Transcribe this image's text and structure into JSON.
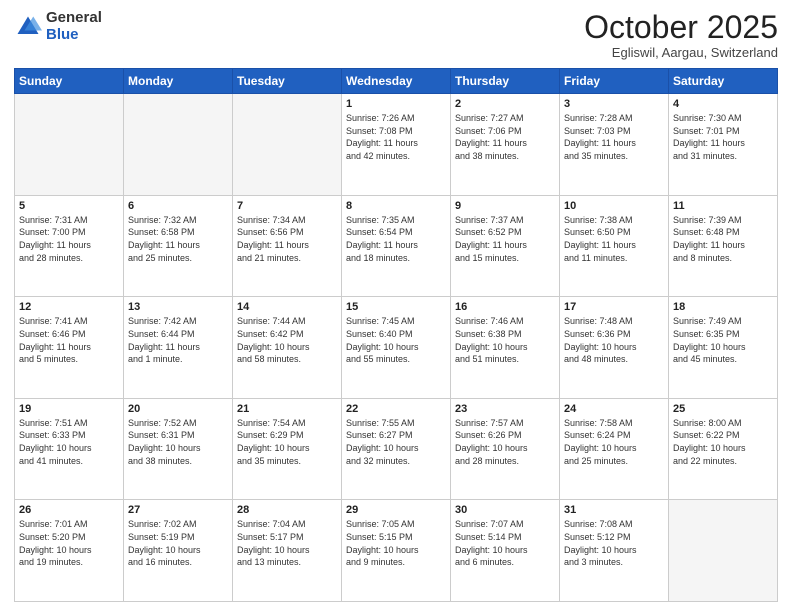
{
  "logo": {
    "general": "General",
    "blue": "Blue"
  },
  "title": {
    "month": "October 2025",
    "location": "Egliswil, Aargau, Switzerland"
  },
  "days_header": [
    "Sunday",
    "Monday",
    "Tuesday",
    "Wednesday",
    "Thursday",
    "Friday",
    "Saturday"
  ],
  "weeks": [
    [
      {
        "day": "",
        "info": ""
      },
      {
        "day": "",
        "info": ""
      },
      {
        "day": "",
        "info": ""
      },
      {
        "day": "1",
        "info": "Sunrise: 7:26 AM\nSunset: 7:08 PM\nDaylight: 11 hours\nand 42 minutes."
      },
      {
        "day": "2",
        "info": "Sunrise: 7:27 AM\nSunset: 7:06 PM\nDaylight: 11 hours\nand 38 minutes."
      },
      {
        "day": "3",
        "info": "Sunrise: 7:28 AM\nSunset: 7:03 PM\nDaylight: 11 hours\nand 35 minutes."
      },
      {
        "day": "4",
        "info": "Sunrise: 7:30 AM\nSunset: 7:01 PM\nDaylight: 11 hours\nand 31 minutes."
      }
    ],
    [
      {
        "day": "5",
        "info": "Sunrise: 7:31 AM\nSunset: 7:00 PM\nDaylight: 11 hours\nand 28 minutes."
      },
      {
        "day": "6",
        "info": "Sunrise: 7:32 AM\nSunset: 6:58 PM\nDaylight: 11 hours\nand 25 minutes."
      },
      {
        "day": "7",
        "info": "Sunrise: 7:34 AM\nSunset: 6:56 PM\nDaylight: 11 hours\nand 21 minutes."
      },
      {
        "day": "8",
        "info": "Sunrise: 7:35 AM\nSunset: 6:54 PM\nDaylight: 11 hours\nand 18 minutes."
      },
      {
        "day": "9",
        "info": "Sunrise: 7:37 AM\nSunset: 6:52 PM\nDaylight: 11 hours\nand 15 minutes."
      },
      {
        "day": "10",
        "info": "Sunrise: 7:38 AM\nSunset: 6:50 PM\nDaylight: 11 hours\nand 11 minutes."
      },
      {
        "day": "11",
        "info": "Sunrise: 7:39 AM\nSunset: 6:48 PM\nDaylight: 11 hours\nand 8 minutes."
      }
    ],
    [
      {
        "day": "12",
        "info": "Sunrise: 7:41 AM\nSunset: 6:46 PM\nDaylight: 11 hours\nand 5 minutes."
      },
      {
        "day": "13",
        "info": "Sunrise: 7:42 AM\nSunset: 6:44 PM\nDaylight: 11 hours\nand 1 minute."
      },
      {
        "day": "14",
        "info": "Sunrise: 7:44 AM\nSunset: 6:42 PM\nDaylight: 10 hours\nand 58 minutes."
      },
      {
        "day": "15",
        "info": "Sunrise: 7:45 AM\nSunset: 6:40 PM\nDaylight: 10 hours\nand 55 minutes."
      },
      {
        "day": "16",
        "info": "Sunrise: 7:46 AM\nSunset: 6:38 PM\nDaylight: 10 hours\nand 51 minutes."
      },
      {
        "day": "17",
        "info": "Sunrise: 7:48 AM\nSunset: 6:36 PM\nDaylight: 10 hours\nand 48 minutes."
      },
      {
        "day": "18",
        "info": "Sunrise: 7:49 AM\nSunset: 6:35 PM\nDaylight: 10 hours\nand 45 minutes."
      }
    ],
    [
      {
        "day": "19",
        "info": "Sunrise: 7:51 AM\nSunset: 6:33 PM\nDaylight: 10 hours\nand 41 minutes."
      },
      {
        "day": "20",
        "info": "Sunrise: 7:52 AM\nSunset: 6:31 PM\nDaylight: 10 hours\nand 38 minutes."
      },
      {
        "day": "21",
        "info": "Sunrise: 7:54 AM\nSunset: 6:29 PM\nDaylight: 10 hours\nand 35 minutes."
      },
      {
        "day": "22",
        "info": "Sunrise: 7:55 AM\nSunset: 6:27 PM\nDaylight: 10 hours\nand 32 minutes."
      },
      {
        "day": "23",
        "info": "Sunrise: 7:57 AM\nSunset: 6:26 PM\nDaylight: 10 hours\nand 28 minutes."
      },
      {
        "day": "24",
        "info": "Sunrise: 7:58 AM\nSunset: 6:24 PM\nDaylight: 10 hours\nand 25 minutes."
      },
      {
        "day": "25",
        "info": "Sunrise: 8:00 AM\nSunset: 6:22 PM\nDaylight: 10 hours\nand 22 minutes."
      }
    ],
    [
      {
        "day": "26",
        "info": "Sunrise: 7:01 AM\nSunset: 5:20 PM\nDaylight: 10 hours\nand 19 minutes."
      },
      {
        "day": "27",
        "info": "Sunrise: 7:02 AM\nSunset: 5:19 PM\nDaylight: 10 hours\nand 16 minutes."
      },
      {
        "day": "28",
        "info": "Sunrise: 7:04 AM\nSunset: 5:17 PM\nDaylight: 10 hours\nand 13 minutes."
      },
      {
        "day": "29",
        "info": "Sunrise: 7:05 AM\nSunset: 5:15 PM\nDaylight: 10 hours\nand 9 minutes."
      },
      {
        "day": "30",
        "info": "Sunrise: 7:07 AM\nSunset: 5:14 PM\nDaylight: 10 hours\nand 6 minutes."
      },
      {
        "day": "31",
        "info": "Sunrise: 7:08 AM\nSunset: 5:12 PM\nDaylight: 10 hours\nand 3 minutes."
      },
      {
        "day": "",
        "info": ""
      }
    ]
  ]
}
